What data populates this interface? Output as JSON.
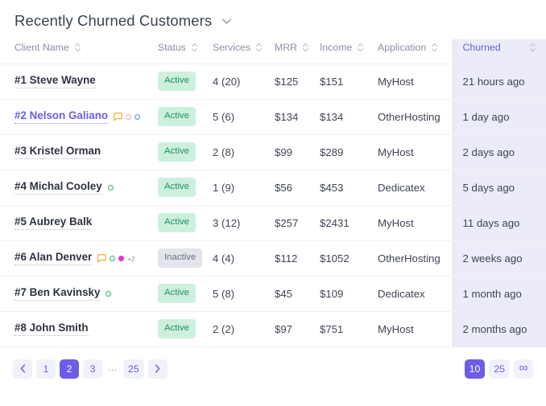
{
  "header": {
    "title": "Recently Churned Customers",
    "dropdown_icon": "chevron-down-icon"
  },
  "table": {
    "columns": [
      {
        "key": "client_name",
        "label": "Client Name",
        "sortable": true,
        "highlighted": false
      },
      {
        "key": "status",
        "label": "Status",
        "sortable": true,
        "highlighted": false
      },
      {
        "key": "services",
        "label": "Services",
        "sortable": true,
        "highlighted": false
      },
      {
        "key": "mrr",
        "label": "MRR",
        "sortable": true,
        "highlighted": false
      },
      {
        "key": "income",
        "label": "Income",
        "sortable": true,
        "highlighted": false
      },
      {
        "key": "application",
        "label": "Application",
        "sortable": true,
        "highlighted": false
      },
      {
        "key": "churned",
        "label": "Churned",
        "sortable": true,
        "highlighted": true
      }
    ],
    "rows": [
      {
        "client_name": "#1 Steve Wayne",
        "name_link": false,
        "icons": [],
        "status": "Active",
        "status_kind": "active",
        "services": "4 (20)",
        "mrr": "$125",
        "income": "$151",
        "application": "MyHost",
        "churned": "21 hours ago"
      },
      {
        "client_name": "#2 Nelson Galiano",
        "name_link": true,
        "icons": [
          {
            "type": "comment-icon",
            "color": "#f5a623"
          },
          {
            "type": "circle-hollow-icon",
            "color": "#f7a2a2"
          },
          {
            "type": "circle-hollow-icon",
            "color": "#3b9dfb"
          }
        ],
        "status": "Active",
        "status_kind": "active",
        "services": "5 (6)",
        "mrr": "$134",
        "income": "$134",
        "application": "OtherHosting",
        "churned": "1 day ago"
      },
      {
        "client_name": "#3 Kristel Orman",
        "name_link": false,
        "icons": [],
        "status": "Active",
        "status_kind": "active",
        "services": "2 (8)",
        "mrr": "$99",
        "income": "$289",
        "application": "MyHost",
        "churned": "2 days ago"
      },
      {
        "client_name": "#4 Michal Cooley",
        "name_link": false,
        "icons": [
          {
            "type": "circle-hollow-icon",
            "color": "#2bb673"
          }
        ],
        "status": "Active",
        "status_kind": "active",
        "services": "1 (9)",
        "mrr": "$56",
        "income": "$453",
        "application": "Dedicatex",
        "churned": "5 days ago"
      },
      {
        "client_name": "#5 Aubrey Balk",
        "name_link": false,
        "icons": [],
        "status": "Active",
        "status_kind": "active",
        "services": "3 (12)",
        "mrr": "$257",
        "income": "$2431",
        "application": "MyHost",
        "churned": "11 days ago"
      },
      {
        "client_name": "#6 Alan Denver",
        "name_link": false,
        "icons": [
          {
            "type": "comment-icon",
            "color": "#f5a623"
          },
          {
            "type": "circle-hollow-icon",
            "color": "#2bb673"
          },
          {
            "type": "circle-solid-icon",
            "color": "#e830c8"
          },
          {
            "type": "more-count-label",
            "label": "+2",
            "color": "#8b8fa3"
          }
        ],
        "status": "Inactive",
        "status_kind": "inactive",
        "services": "4 (4)",
        "mrr": "$112",
        "income": "$1052",
        "application": "OtherHosting",
        "churned": "2 weeks ago"
      },
      {
        "client_name": "#7 Ben Kavinsky",
        "name_link": false,
        "icons": [
          {
            "type": "circle-hollow-icon",
            "color": "#2bb673"
          }
        ],
        "status": "Active",
        "status_kind": "active",
        "services": "5 (8)",
        "mrr": "$45",
        "income": "$109",
        "application": "Dedicatex",
        "churned": "1 month ago"
      },
      {
        "client_name": "#8 John Smith",
        "name_link": false,
        "icons": [],
        "status": "Active",
        "status_kind": "active",
        "services": "2 (2)",
        "mrr": "$97",
        "income": "$751",
        "application": "MyHost",
        "churned": "2 months ago"
      }
    ]
  },
  "pagination": {
    "prev_icon": "chevron-left-icon",
    "next_icon": "chevron-right-icon",
    "pages": [
      {
        "label": "1",
        "active": false,
        "kind": "page"
      },
      {
        "label": "2",
        "active": true,
        "kind": "page"
      },
      {
        "label": "3",
        "active": false,
        "kind": "page"
      },
      {
        "label": "...",
        "active": false,
        "kind": "ellipsis"
      },
      {
        "label": "25",
        "active": false,
        "kind": "page"
      }
    ],
    "page_sizes": [
      {
        "label": "10",
        "active": true,
        "kind": "size"
      },
      {
        "label": "25",
        "active": false,
        "kind": "size"
      },
      {
        "label": "∞",
        "active": false,
        "kind": "size-infinite"
      }
    ]
  },
  "colors": {
    "accent": "#6c5ce7",
    "accent_soft": "#ececf9",
    "accent_btn_bg": "#f1f1fb",
    "badge_active_bg": "#cdf0dd",
    "badge_active_fg": "#1f9254",
    "badge_inactive_bg": "#e3e5ea",
    "badge_inactive_fg": "#6b7280",
    "text_primary": "#3f4454",
    "text_muted": "#8b8fa3",
    "row_border": "#f0f1f5"
  }
}
